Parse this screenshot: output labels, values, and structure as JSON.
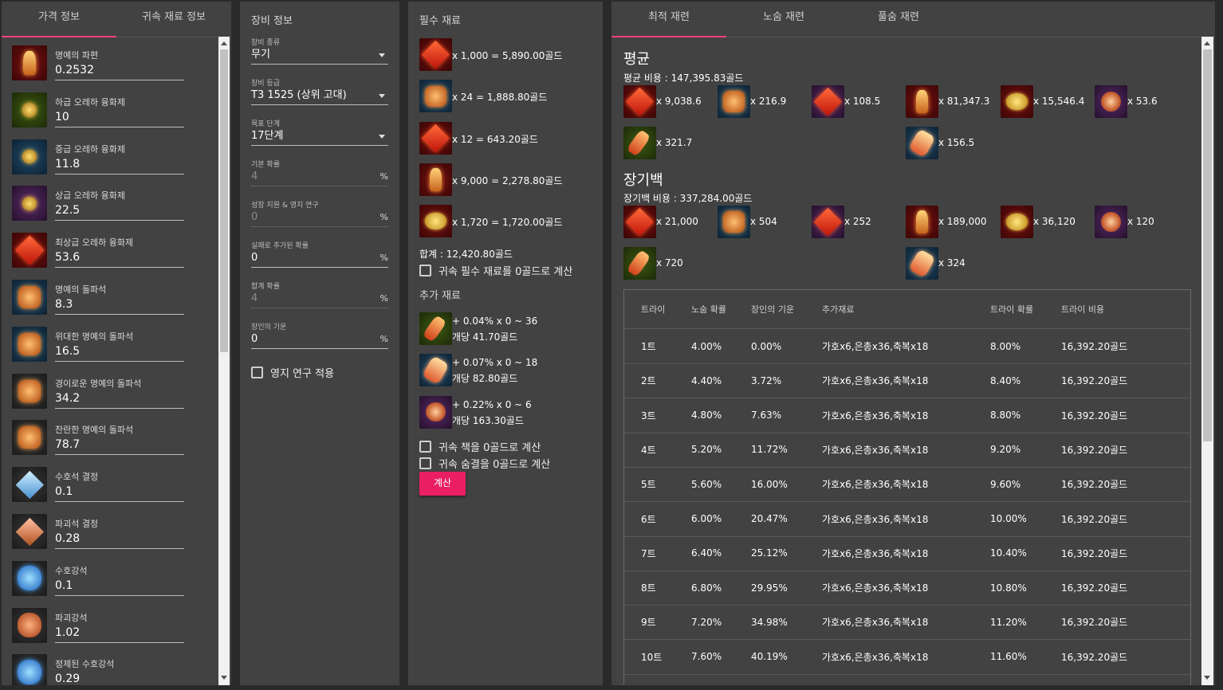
{
  "panel1": {
    "tabs": [
      "가격 정보",
      "귀속 재료 정보"
    ],
    "items": [
      {
        "name": "명예의 파편",
        "value": "0.2532",
        "icon": "honor-shard-icon",
        "bg": "bg-red",
        "glyph": "g-lantern"
      },
      {
        "name": "하급 오레하 융화제",
        "value": "10",
        "icon": "low-oreha-fusion-icon",
        "bg": "bg-green",
        "glyph": "g-orb"
      },
      {
        "name": "중급 오레하 융화제",
        "value": "11.8",
        "icon": "mid-oreha-fusion-icon",
        "bg": "bg-blue",
        "glyph": "g-orb"
      },
      {
        "name": "상급 오레하 융화제",
        "value": "22.5",
        "icon": "high-oreha-fusion-icon",
        "bg": "bg-purple",
        "glyph": "g-orb"
      },
      {
        "name": "최상급 오레하 융화제",
        "value": "53.6",
        "icon": "top-oreha-fusion-icon",
        "bg": "bg-red",
        "glyph": "g-gem"
      },
      {
        "name": "명예의 돌파석",
        "value": "8.3",
        "icon": "honor-leapstone-icon",
        "bg": "bg-blue",
        "glyph": "g-crest"
      },
      {
        "name": "위대한 명예의 돌파석",
        "value": "16.5",
        "icon": "great-honor-leapstone-icon",
        "bg": "bg-blue",
        "glyph": "g-crest"
      },
      {
        "name": "경이로운 명예의 돌파석",
        "value": "34.2",
        "icon": "marvelous-honor-leapstone-icon",
        "bg": "bg-dark",
        "glyph": "g-crest"
      },
      {
        "name": "찬란한 명예의 돌파석",
        "value": "78.7",
        "icon": "radiant-honor-leapstone-icon",
        "bg": "bg-dark",
        "glyph": "g-crest"
      },
      {
        "name": "수호석 결정",
        "value": "0.1",
        "icon": "guardian-crystal-icon",
        "bg": "bg-dark",
        "glyph": "g-crystal-blue"
      },
      {
        "name": "파괴석 결정",
        "value": "0.28",
        "icon": "destruction-crystal-icon",
        "bg": "bg-dark",
        "glyph": "g-crystal-orange"
      },
      {
        "name": "수호강석",
        "value": "0.1",
        "icon": "guardian-stone-icon",
        "bg": "bg-dark",
        "glyph": "g-stone-blue"
      },
      {
        "name": "파괴강석",
        "value": "1.02",
        "icon": "destruction-stone-icon",
        "bg": "bg-dark",
        "glyph": "g-stone-orange"
      },
      {
        "name": "정제된 수호강석",
        "value": "0.29",
        "icon": "refined-guardian-stone-icon",
        "bg": "bg-dark",
        "glyph": "g-stone-blue"
      }
    ]
  },
  "panel2": {
    "title": "장비 정보",
    "fields": [
      {
        "label": "장비 종류",
        "value": "무기",
        "kind": "select"
      },
      {
        "label": "장비 등급",
        "value": "T3 1525 (상위 고대)",
        "kind": "select"
      },
      {
        "label": "목표 단계",
        "value": "17단계",
        "kind": "select"
      },
      {
        "label": "기본 확률",
        "value": "4",
        "suffix": "%",
        "kind": "disabled"
      },
      {
        "label": "성장 지원 & 영지 연구",
        "value": "0",
        "suffix": "%",
        "kind": "disabled"
      },
      {
        "label": "실패로 추가된 확률",
        "value": "0",
        "suffix": "%",
        "kind": "text"
      },
      {
        "label": "합계 확률",
        "value": "4",
        "suffix": "%",
        "kind": "disabled"
      },
      {
        "label": "장인의 기운",
        "value": "0",
        "suffix": "%",
        "kind": "text"
      }
    ],
    "checkbox": "영지 연구 적용"
  },
  "panel3": {
    "title": "필수 재료",
    "required": [
      {
        "text": "x 1,000 = 5,890.00골드",
        "icon": "destruction-stone-icon",
        "bg": "bg-red",
        "glyph": "g-gem"
      },
      {
        "text": "x 24 = 1,888.80골드",
        "icon": "leapstone-icon",
        "bg": "bg-blue",
        "glyph": "g-crest"
      },
      {
        "text": "x 12 = 643.20골드",
        "icon": "fusion-material-icon",
        "bg": "bg-red",
        "glyph": "g-gem"
      },
      {
        "text": "x 9,000 = 2,278.80골드",
        "icon": "honor-shard-icon",
        "bg": "bg-red",
        "glyph": "g-lantern"
      },
      {
        "text": "x 1,720 = 1,720.00골드",
        "icon": "gold-coin-icon",
        "bg": "bg-red",
        "glyph": "g-coin"
      }
    ],
    "total": "합계 : 12,420.80골드",
    "required_free_label": "귀속 필수 재료를 0골드로 계산",
    "extra_title": "추가 재료",
    "extra": [
      {
        "line1": "+ 0.04% x 0 ~ 36",
        "line2": "개당 41.70골드",
        "icon": "solar-grace-icon",
        "bg": "bg-green",
        "glyph": "g-shard"
      },
      {
        "line1": "+ 0.07% x 0 ~ 18",
        "line2": "개당 82.80골드",
        "icon": "solar-blessing-icon",
        "bg": "bg-blue",
        "glyph": "g-burst"
      },
      {
        "line1": "+ 0.22% x 0 ~ 6",
        "line2": "개당 163.30골드",
        "icon": "solar-protection-icon",
        "bg": "bg-purple",
        "glyph": "g-flower"
      }
    ],
    "book_free_label": "귀속 책을 0골드로 계산",
    "breath_free_label": "귀속 숨결을 0골드로 계산",
    "calc_button": "계산"
  },
  "panel4": {
    "tabs": [
      "최적 재련",
      "노숨 재련",
      "풀숨 재련"
    ],
    "average": {
      "title": "평균",
      "cost": "평균 비용 : 147,395.83골드",
      "mats_row1": [
        {
          "q": "x 9,038.6",
          "icon": "destruction-stone-icon",
          "bg": "bg-red",
          "glyph": "g-gem"
        },
        {
          "q": "x 216.9",
          "icon": "leapstone-icon",
          "bg": "bg-blue",
          "glyph": "g-crest"
        },
        {
          "q": "x 108.5",
          "icon": "fusion-material-icon",
          "bg": "bg-purple",
          "glyph": "g-gem"
        },
        {
          "q": "x 81,347.3",
          "icon": "honor-shard-icon",
          "bg": "bg-red",
          "glyph": "g-lantern"
        },
        {
          "q": "x 15,546.4",
          "icon": "gold-coin-icon",
          "bg": "bg-red",
          "glyph": "g-coin"
        },
        {
          "q": "x 53.6",
          "icon": "solar-protection-icon",
          "bg": "bg-purple",
          "glyph": "g-flower"
        }
      ],
      "mats_row2": [
        {
          "q": "x 321.7",
          "icon": "solar-grace-icon",
          "bg": "bg-green",
          "glyph": "g-shard"
        },
        {
          "q": "x 156.5",
          "icon": "solar-blessing-icon",
          "bg": "bg-blue",
          "glyph": "g-burst"
        }
      ]
    },
    "pity": {
      "title": "장기백",
      "cost": "장기백 비용 : 337,284.00골드",
      "mats_row1": [
        {
          "q": "x 21,000",
          "icon": "destruction-stone-icon",
          "bg": "bg-red",
          "glyph": "g-gem"
        },
        {
          "q": "x 504",
          "icon": "leapstone-icon",
          "bg": "bg-blue",
          "glyph": "g-crest"
        },
        {
          "q": "x 252",
          "icon": "fusion-material-icon",
          "bg": "bg-purple",
          "glyph": "g-gem"
        },
        {
          "q": "x 189,000",
          "icon": "honor-shard-icon",
          "bg": "bg-red",
          "glyph": "g-lantern"
        },
        {
          "q": "x 36,120",
          "icon": "gold-coin-icon",
          "bg": "bg-red",
          "glyph": "g-coin"
        },
        {
          "q": "x 120",
          "icon": "solar-protection-icon",
          "bg": "bg-purple",
          "glyph": "g-flower"
        }
      ],
      "mats_row2": [
        {
          "q": "x 720",
          "icon": "solar-grace-icon",
          "bg": "bg-green",
          "glyph": "g-shard"
        },
        {
          "q": "x 324",
          "icon": "solar-blessing-icon",
          "bg": "bg-blue",
          "glyph": "g-burst"
        }
      ]
    },
    "table": {
      "headers": [
        "트라이",
        "노숨 확률",
        "장인의 기운",
        "추가재료",
        "트라이 확률",
        "트라이 비용"
      ],
      "rows": [
        [
          "1트",
          "4.00%",
          "0.00%",
          "가호x6,은총x36,축복x18",
          "8.00%",
          "16,392.20골드"
        ],
        [
          "2트",
          "4.40%",
          "3.72%",
          "가호x6,은총x36,축복x18",
          "8.40%",
          "16,392.20골드"
        ],
        [
          "3트",
          "4.80%",
          "7.63%",
          "가호x6,은총x36,축복x18",
          "8.80%",
          "16,392.20골드"
        ],
        [
          "4트",
          "5.20%",
          "11.72%",
          "가호x6,은총x36,축복x18",
          "9.20%",
          "16,392.20골드"
        ],
        [
          "5트",
          "5.60%",
          "16.00%",
          "가호x6,은총x36,축복x18",
          "9.60%",
          "16,392.20골드"
        ],
        [
          "6트",
          "6.00%",
          "20.47%",
          "가호x6,은총x36,축복x18",
          "10.00%",
          "16,392.20골드"
        ],
        [
          "7트",
          "6.40%",
          "25.12%",
          "가호x6,은총x36,축복x18",
          "10.40%",
          "16,392.20골드"
        ],
        [
          "8트",
          "6.80%",
          "29.95%",
          "가호x6,은총x36,축복x18",
          "10.80%",
          "16,392.20골드"
        ],
        [
          "9트",
          "7.20%",
          "34.98%",
          "가호x6,은총x36,축복x18",
          "11.20%",
          "16,392.20골드"
        ],
        [
          "10트",
          "7.60%",
          "40.19%",
          "가호x6,은총x36,축복x18",
          "11.60%",
          "16,392.20골드"
        ]
      ]
    }
  },
  "colors": {
    "accent": "#ff4081",
    "button": "#e91e63",
    "panel": "#424242",
    "background": "#2a2a2a"
  }
}
